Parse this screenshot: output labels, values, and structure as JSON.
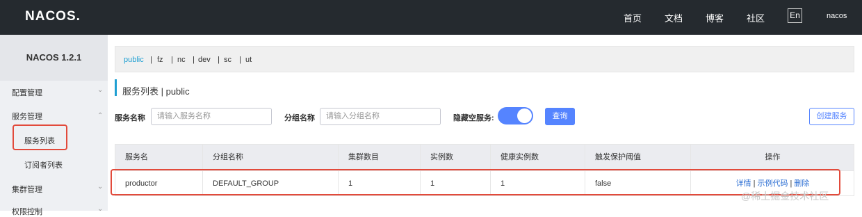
{
  "header": {
    "logo": "NACOS.",
    "nav": [
      "首页",
      "文档",
      "博客",
      "社区"
    ],
    "lang": "En",
    "user": "nacos"
  },
  "sidebar": {
    "title": "NACOS 1.2.1",
    "items": [
      {
        "label": "配置管理",
        "chevron": "down"
      },
      {
        "label": "服务管理",
        "chevron": "up"
      },
      {
        "label": "服务列表",
        "sub": true,
        "active": true
      },
      {
        "label": "订阅者列表",
        "sub": true
      },
      {
        "label": "集群管理",
        "chevron": "down"
      },
      {
        "label": "权限控制",
        "chevron": "down"
      }
    ]
  },
  "namespaces": [
    "public",
    "fz",
    "nc",
    "dev",
    "sc",
    "ut"
  ],
  "active_namespace": "public",
  "page": {
    "title": "服务列表 | public"
  },
  "filters": {
    "service_label": "服务名称",
    "service_placeholder": "请输入服务名称",
    "group_label": "分组名称",
    "group_placeholder": "请输入分组名称",
    "hide_empty_label": "隐藏空服务:",
    "hide_empty_on": true,
    "query_button": "查询",
    "create_button": "创建服务"
  },
  "table": {
    "columns": [
      "服务名",
      "分组名称",
      "集群数目",
      "实例数",
      "健康实例数",
      "触发保护阈值",
      "操作"
    ],
    "rows": [
      {
        "service": "productor",
        "group": "DEFAULT_GROUP",
        "clusters": "1",
        "instances": "1",
        "healthy": "1",
        "threshold": "false",
        "ops": [
          "详情",
          "示例代码",
          "删除"
        ]
      }
    ]
  },
  "watermark": "@稀土掘金技术社区",
  "colors": {
    "topbar": "#252a2f",
    "accent": "#5584ff",
    "namespace_active": "#1e9fd2",
    "highlight_box": "#e24a3b"
  }
}
